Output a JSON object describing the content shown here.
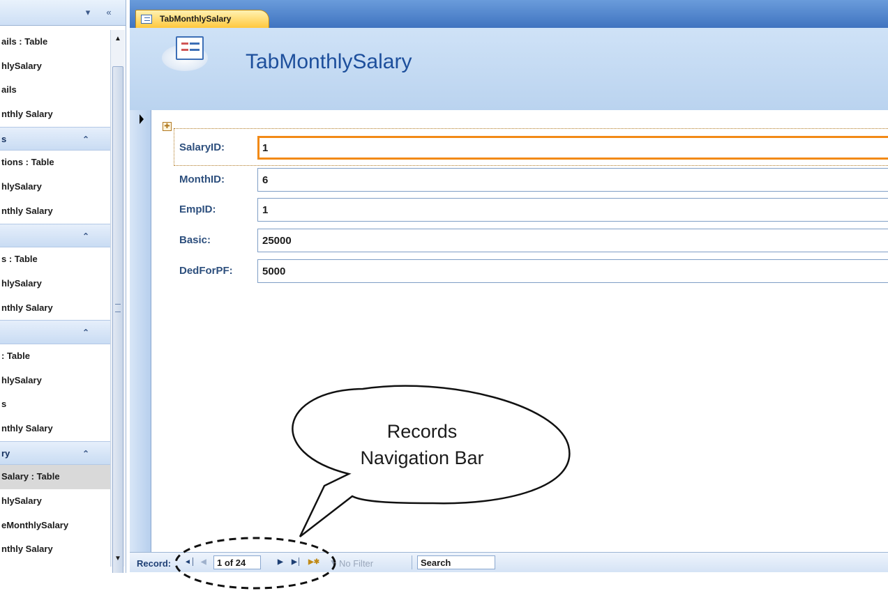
{
  "nav_pane": {
    "items": [
      {
        "label": "ails : Table",
        "kind": "item"
      },
      {
        "label": "hlySalary",
        "kind": "item"
      },
      {
        "label": "ails",
        "kind": "item"
      },
      {
        "label": "nthly Salary",
        "kind": "item"
      },
      {
        "label": "s",
        "kind": "group"
      },
      {
        "label": "tions : Table",
        "kind": "item"
      },
      {
        "label": "hlySalary",
        "kind": "item"
      },
      {
        "label": "nthly Salary",
        "kind": "item"
      },
      {
        "label": "",
        "kind": "group"
      },
      {
        "label": "s : Table",
        "kind": "item"
      },
      {
        "label": "hlySalary",
        "kind": "item"
      },
      {
        "label": "nthly Salary",
        "kind": "item"
      },
      {
        "label": "",
        "kind": "group"
      },
      {
        "label": ": Table",
        "kind": "item"
      },
      {
        "label": "hlySalary",
        "kind": "item"
      },
      {
        "label": "s",
        "kind": "item"
      },
      {
        "label": "nthly Salary",
        "kind": "item"
      },
      {
        "label": "ry",
        "kind": "group"
      },
      {
        "label": "Salary : Table",
        "kind": "selected"
      },
      {
        "label": "hlySalary",
        "kind": "item"
      },
      {
        "label": "eMonthlySalary",
        "kind": "item"
      },
      {
        "label": "nthly Salary",
        "kind": "item"
      }
    ]
  },
  "tab": {
    "label": "TabMonthlySalary"
  },
  "form": {
    "title": "TabMonthlySalary",
    "fields": [
      {
        "label": "SalaryID:",
        "value": "1"
      },
      {
        "label": "MonthID:",
        "value": "6"
      },
      {
        "label": "EmpID:",
        "value": "1"
      },
      {
        "label": "Basic:",
        "value": "25000"
      },
      {
        "label": "DedForPF:",
        "value": "5000"
      }
    ]
  },
  "record_nav": {
    "label": "Record:",
    "counter": "1 of 24",
    "filter": "No Filter",
    "search": "Search"
  },
  "callout": {
    "line1": "Records",
    "line2": "Navigation Bar"
  },
  "colors": {
    "active_field_border": "#f28a16",
    "tab_fill": "#ffc83d",
    "header_fill": "#c6dbf3",
    "title_text": "#1d4f9c"
  }
}
